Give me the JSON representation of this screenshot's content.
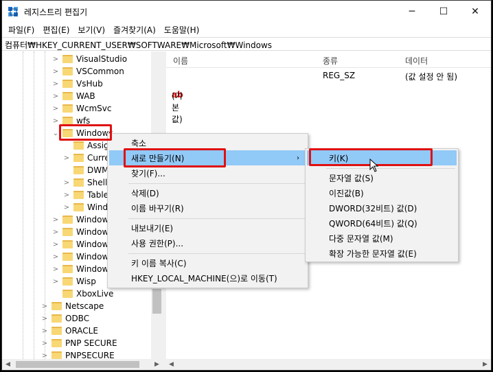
{
  "window": {
    "title": "레지스트리 편집기",
    "controls": {
      "minimize": "─",
      "maximize": "☐",
      "close": "✕"
    }
  },
  "menubar": [
    "파일(F)",
    "편집(E)",
    "보기(V)",
    "즐겨찾기(A)",
    "도움말(H)"
  ],
  "address": "컴퓨터₩HKEY_CURRENT_USER₩SOFTWARE₩Microsoft₩Windows",
  "tree": {
    "items": [
      {
        "label": "VisualStudio",
        "expander": ">"
      },
      {
        "label": "VSCommon",
        "expander": ">"
      },
      {
        "label": "VsHub",
        "expander": ">"
      },
      {
        "label": "WAB",
        "expander": ">"
      },
      {
        "label": "WcmSvc",
        "expander": ">"
      },
      {
        "label": "wfs",
        "expander": ">"
      },
      {
        "label": "Windows",
        "expander": "v",
        "selected": true
      },
      {
        "label": "Assign",
        "expander": ""
      },
      {
        "label": "Curre",
        "expander": ">"
      },
      {
        "label": "DWM",
        "expander": ""
      },
      {
        "label": "Shell",
        "expander": ">"
      },
      {
        "label": "Tablet",
        "expander": ">"
      },
      {
        "label": "Windo",
        "expander": ">"
      },
      {
        "label": "Windows",
        "expander": ">"
      },
      {
        "label": "Windows",
        "expander": ">"
      },
      {
        "label": "Windows",
        "expander": ">"
      },
      {
        "label": "Windows",
        "expander": ">"
      },
      {
        "label": "Windows",
        "expander": ">"
      },
      {
        "label": "Wisp",
        "expander": ">"
      },
      {
        "label": "XboxLive",
        "expander": ""
      },
      {
        "label": "Netscape",
        "expander": ">"
      },
      {
        "label": "ODBC",
        "expander": ">"
      },
      {
        "label": "ORACLE",
        "expander": ">"
      },
      {
        "label": "PNP SECURE",
        "expander": ">"
      },
      {
        "label": "PNPSECURE",
        "expander": ">"
      }
    ]
  },
  "list": {
    "headers": {
      "name": "이름",
      "type": "종류",
      "data": "데이터"
    },
    "rows": [
      {
        "icon": "ab",
        "name": "(기본값)",
        "type": "REG_SZ",
        "data": "(값 설정 안 됨)"
      }
    ]
  },
  "context_menu": {
    "items": [
      {
        "label": "축소"
      },
      {
        "label": "새로 만들기(N)",
        "submenu": "›",
        "highlighted": true
      },
      {
        "label": "찾기(F)..."
      },
      {
        "label": "삭제(D)"
      },
      {
        "label": "이름 바꾸기(R)"
      },
      {
        "label": "내보내기(E)"
      },
      {
        "label": "사용 권한(P)..."
      },
      {
        "label": "키 이름 복사(C)"
      },
      {
        "label": "HKEY_LOCAL_MACHINE(으)로 이동(T)"
      }
    ]
  },
  "submenu": {
    "items": [
      {
        "label": "키(K)",
        "highlighted": true
      },
      {
        "label": "문자열 값(S)"
      },
      {
        "label": "이진값(B)"
      },
      {
        "label": "DWORD(32비트) 값(D)"
      },
      {
        "label": "QWORD(64비트) 값(Q)"
      },
      {
        "label": "다중 문자열 값(M)"
      },
      {
        "label": "확장 가능한 문자열 값(E)"
      }
    ]
  },
  "colors": {
    "highlight": "#91c9f7",
    "annotation": "#e01010",
    "folder": "#f8d775"
  }
}
